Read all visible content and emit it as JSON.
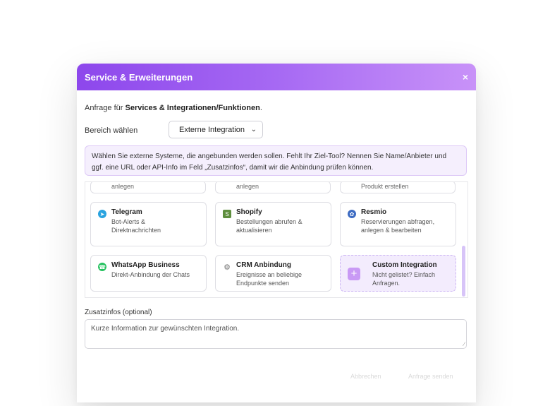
{
  "modal": {
    "title": "Service & Erweiterungen",
    "close": "×"
  },
  "intro": {
    "prefix": "Anfrage für ",
    "bold": "Services & Integrationen/Funktionen",
    "suffix": "."
  },
  "bereich": {
    "label": "Bereich wählen",
    "selected": "Externe Integration"
  },
  "info": "Wählen Sie externe Systeme, die angebunden werden sollen. Fehlt Ihr Ziel-Tool? Nennen Sie Name/Anbieter und ggf. eine URL oder API-Info im Feld „Zusatzinfos“, damit wir die Anbindung prüfen können.",
  "partial_cards": [
    "anlegen",
    "anlegen",
    "Produkt erstellen"
  ],
  "cards": [
    {
      "title": "Telegram",
      "desc": "Bot-Alerts & Direktnachrichten",
      "icon": "telegram-icon",
      "color": "#2aa3df"
    },
    {
      "title": "Shopify",
      "desc": "Bestellungen abrufen & aktualisieren",
      "icon": "shopify-icon",
      "color": "#5e8e3e"
    },
    {
      "title": "Resmio",
      "desc": "Reservierungen abfragen, anlegen & bearbeiten",
      "icon": "resmio-icon",
      "color": "#3d6bc2"
    },
    {
      "title": "WhatsApp Business",
      "desc": "Direkt-Anbindung der Chats",
      "icon": "whatsapp-icon",
      "color": "#25c15f"
    },
    {
      "title": "CRM Anbindung",
      "desc": "Ereignisse an beliebige Endpunkte senden",
      "icon": "gear-icon",
      "color": "#888888"
    }
  ],
  "custom_card": {
    "title": "Custom Integration",
    "desc": "Nicht gelistet? Einfach Anfragen.",
    "plus": "+"
  },
  "zusatz": {
    "label": "Zusatzinfos (optional)",
    "placeholder": "Kurze Information zur gewünschten Integration."
  },
  "footer": {
    "cancel": "Abbrechen",
    "submit": "Anfrage senden"
  },
  "colors": {
    "accent": "#8d47ec",
    "info_bg": "#f5effd"
  }
}
